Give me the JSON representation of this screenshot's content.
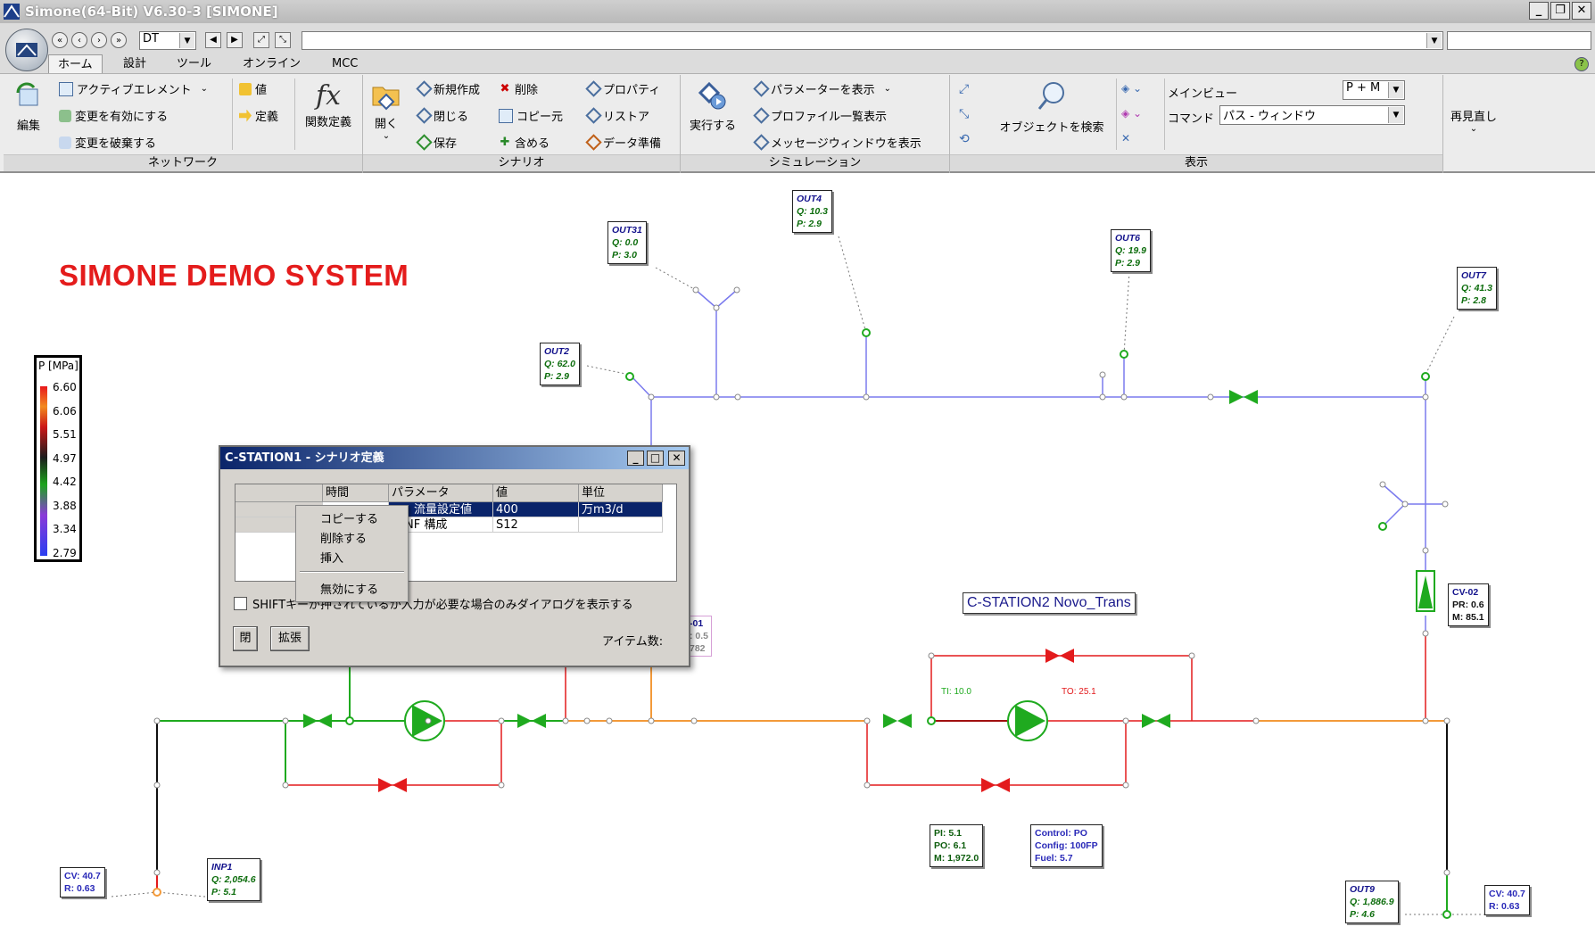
{
  "window": {
    "title": "Simone(64-Bit) V6.30-3 [SIMONE]"
  },
  "toolbar": {
    "dt_value": "DT"
  },
  "tabs": [
    {
      "label": "ホーム"
    },
    {
      "label": "設計"
    },
    {
      "label": "ツール"
    },
    {
      "label": "オンライン"
    },
    {
      "label": "MCC"
    }
  ],
  "ribbon": {
    "network": {
      "label": "ネットワーク",
      "edit": "編集",
      "active_element": "アクティブエレメント",
      "enable_changes": "変更を有効にする",
      "discard_changes": "変更を破棄する",
      "value": "値",
      "definition": "定義",
      "function_def": "関数定義"
    },
    "scenario": {
      "label": "シナリオ",
      "open": "開く",
      "new": "新規作成",
      "close": "閉じる",
      "save": "保存",
      "delete": "削除",
      "copy_from": "コピー元",
      "include": "含める",
      "properties": "プロパティ",
      "restore": "リストア",
      "data_prep": "データ準備"
    },
    "simulation": {
      "label": "シミュレーション",
      "run": "実行する",
      "show_params": "パラメーターを表示",
      "profile_list": "プロファイル一覧表示",
      "message_window": "メッセージウィンドウを表示"
    },
    "view": {
      "label": "表示",
      "find_object": "オブジェクトを検索",
      "main_view_label": "メインビュー",
      "main_view_value": "P + M",
      "command_label": "コマンド",
      "command_value": "パス - ウィンドウ",
      "redraw": "再見直し"
    }
  },
  "canvas": {
    "title": "SIMONE DEMO SYSTEM",
    "legend": {
      "title": "P [MPa]",
      "ticks": [
        "6.60",
        "6.06",
        "5.51",
        "4.97",
        "4.42",
        "3.88",
        "3.34",
        "2.79"
      ]
    },
    "station2_label": "C-STATION2  Novo_Trans",
    "ti": "TI: 10.0",
    "to": "TO: 25.1",
    "nodes": {
      "out31": {
        "name": "OUT31",
        "q": "Q: 0.0",
        "p": "P: 3.0"
      },
      "out4": {
        "name": "OUT4",
        "q": "Q: 10.3",
        "p": "P: 2.9"
      },
      "out6": {
        "name": "OUT6",
        "q": "Q: 19.9",
        "p": "P: 2.9"
      },
      "out7": {
        "name": "OUT7",
        "q": "Q: 41.3",
        "p": "P: 2.8"
      },
      "out2": {
        "name": "OUT2",
        "q": "Q: 62.0",
        "p": "P: 2.9"
      },
      "inp1": {
        "name": "INP1",
        "q": "Q: 2,054.6",
        "p": "P: 5.1"
      },
      "out9": {
        "name": "OUT9",
        "q": "Q: 1,886.9",
        "p": "P: 4.6"
      },
      "cv02": {
        "name": "CV-02",
        "pr": "PR: 0.6",
        "m": "M: 85.1"
      },
      "cv_left": {
        "cv": "CV: 40.7",
        "r": "R: 0.63"
      },
      "cv_right": {
        "cv": "CV: 40.7",
        "r": "R: 0.63"
      },
      "station_vals": {
        "pi": "PI: 5.1",
        "po": "PO: 6.1",
        "m": "M: 1,972.0"
      },
      "control": {
        "control": "Control: PO",
        "config": "Config: 100FP",
        "fuel": "Fuel: 5.7"
      },
      "c01_partial": {
        "name": "-01",
        "v1": ": 0.5",
        "v2": "782"
      }
    }
  },
  "dialog": {
    "title": "C-STATION1 - シナリオ定義",
    "columns": [
      "時間",
      "パラメータ",
      "値",
      "単位"
    ],
    "rows": [
      {
        "time": "",
        "param": "流量設定値",
        "value": "400",
        "unit": "万m3/d"
      },
      {
        "time": "",
        "param": "NF 構成",
        "value": "S12",
        "unit": ""
      }
    ],
    "checkbox_label": "SHIFTキーが押されているか入力が必要な場合のみダイアログを表示する",
    "close_button": "閉",
    "expand_button": "拡張",
    "item_count_label": "アイテム数:"
  },
  "context_menu": {
    "items": [
      "コピーする",
      "削除する",
      "挿入",
      "無効にする"
    ]
  },
  "colors": {
    "high_pressure": "#e31a1c",
    "mid_pressure": "#f39a3a",
    "low_pressure": "#1faa1f",
    "distribution": "#7a7aee"
  }
}
